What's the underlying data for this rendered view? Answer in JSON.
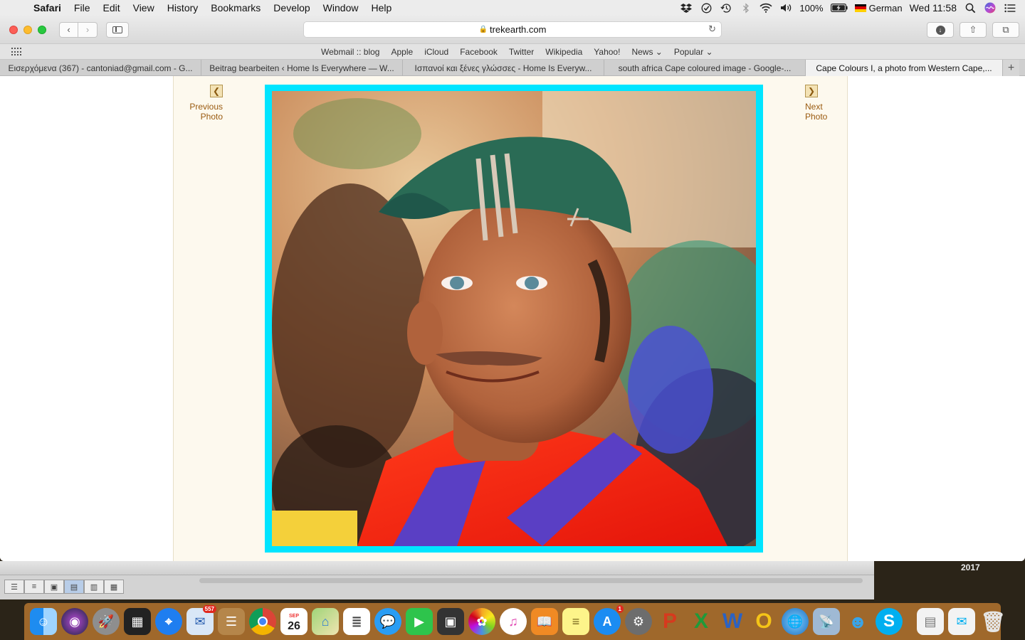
{
  "menubar": {
    "app": "Safari",
    "items": [
      "File",
      "Edit",
      "View",
      "History",
      "Bookmarks",
      "Develop",
      "Window",
      "Help"
    ],
    "battery": "100%",
    "input_source": "German",
    "clock": "Wed 11:58"
  },
  "toolbar": {
    "url": "trekearth.com"
  },
  "favorites": [
    "Webmail :: blog",
    "Apple",
    "iCloud",
    "Facebook",
    "Twitter",
    "Wikipedia",
    "Yahoo!",
    "News ⌄",
    "Popular ⌄"
  ],
  "tabs": [
    {
      "label": "Εισερχόμενα (367) - cantoniad@gmail.com - G..."
    },
    {
      "label": "Beitrag bearbeiten ‹ Home Is Everywhere — W..."
    },
    {
      "label": "Ισπανοί και ξένες γλώσσες - Home Is Everyw..."
    },
    {
      "label": "south africa Cape coloured image - Google-..."
    },
    {
      "label": "Cape Colours I, a photo from Western Cape,..."
    }
  ],
  "page": {
    "prev_line1": "Previous",
    "prev_line2": "Photo",
    "next_line1": "Next",
    "next_line2": "Photo",
    "frame_color": "#00e5ff"
  },
  "desktop": {
    "year_label": "2017"
  },
  "dock": {
    "mail_badge": "557",
    "calendar_month": "SEP",
    "calendar_day": "26",
    "appstore_badge": "1"
  }
}
